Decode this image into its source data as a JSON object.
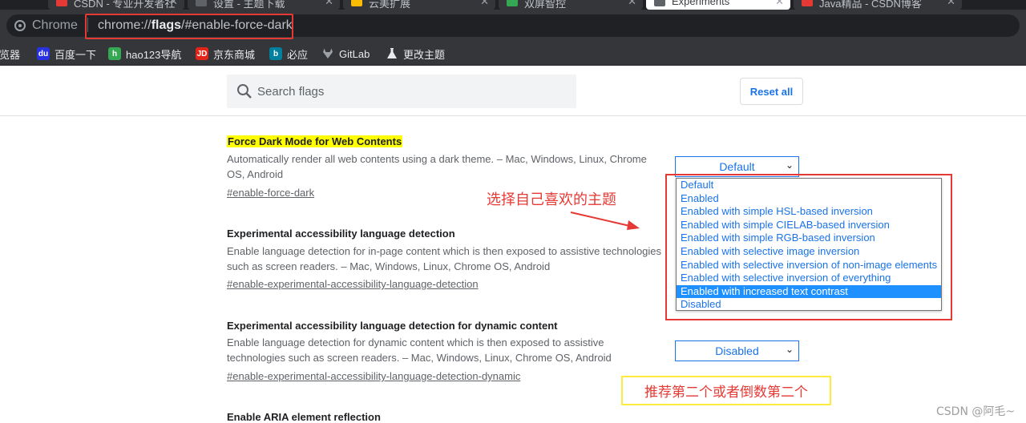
{
  "tabs": [
    {
      "title": "CSDN - 专业开发者社",
      "favicon_color": "#e53935",
      "active": false
    },
    {
      "title": "设置 - 主题下载",
      "favicon_color": "#5f6368",
      "active": false
    },
    {
      "title": "云美扩展",
      "favicon_color": "#fbbc04",
      "active": false
    },
    {
      "title": "双屏智控",
      "favicon_color": "#34a853",
      "active": false
    },
    {
      "title": "Experiments",
      "favicon_color": "#5f6368",
      "active": true
    },
    {
      "title": "Java精品 - CSDN博客",
      "favicon_color": "#e53935",
      "active": false
    }
  ],
  "omnibox": {
    "site_label": "Chrome",
    "url_scheme": "chrome://",
    "url_host": "flags",
    "url_path": "/#enable-force-dark"
  },
  "bookmarks": [
    {
      "label": "浏览器",
      "icon": "globe-icon",
      "color": "#4285f4",
      "glyph": ""
    },
    {
      "label": "百度一下",
      "icon": "baidu-icon",
      "color": "#2932e1",
      "glyph": "du"
    },
    {
      "label": "hao123导航",
      "icon": "hao123-icon",
      "color": "#34a853",
      "glyph": "h"
    },
    {
      "label": "京东商城",
      "icon": "jd-icon",
      "color": "#e1251b",
      "glyph": "JD"
    },
    {
      "label": "必应",
      "icon": "bing-icon",
      "color": "#00809d",
      "glyph": "b"
    },
    {
      "label": "GitLab",
      "icon": "gitlab-icon",
      "color": "#fc6d26",
      "glyph": ""
    },
    {
      "label": "更改主题",
      "icon": "flask-icon",
      "color": "#e8eaed",
      "glyph": ""
    }
  ],
  "search": {
    "placeholder": "Search flags"
  },
  "reset_label": "Reset all",
  "flags": [
    {
      "title": "Force Dark Mode for Web Contents",
      "description": "Automatically render all web contents using a dark theme. – Mac, Windows, Linux, Chrome OS, Android",
      "link": "#enable-force-dark",
      "value": "Default"
    },
    {
      "title": "Experimental accessibility language detection",
      "description": "Enable language detection for in-page content which is then exposed to assistive technologies such as screen readers. – Mac, Windows, Linux, Chrome OS, Android",
      "link": "#enable-experimental-accessibility-language-detection",
      "value": ""
    },
    {
      "title": "Experimental accessibility language detection for dynamic content",
      "description": "Enable language detection for dynamic content which is then exposed to assistive technologies such as screen readers. – Mac, Windows, Linux, Chrome OS, Android",
      "link": "#enable-experimental-accessibility-language-detection-dynamic",
      "value": "Disabled"
    },
    {
      "title": "Enable ARIA element reflection",
      "description": "",
      "link": "",
      "value": ""
    }
  ],
  "dropdown": {
    "options": [
      "Default",
      "Enabled",
      "Enabled with simple HSL-based inversion",
      "Enabled with simple CIELAB-based inversion",
      "Enabled with simple RGB-based inversion",
      "Enabled with selective image inversion",
      "Enabled with selective inversion of non-image elements",
      "Enabled with selective inversion of everything",
      "Enabled with increased text contrast",
      "Disabled"
    ],
    "highlighted": "Enabled with increased text contrast"
  },
  "annotations": {
    "choose_theme": "选择自己喜欢的主题",
    "recommend": "推荐第二个或者倒数第二个",
    "watermark": "CSDN @阿毛~"
  },
  "colors": {
    "annotation_red": "#e53935",
    "annotation_yellow": "#ffeb3b",
    "link_blue": "#1a73e8",
    "flag_highlight": "#ffff00"
  }
}
